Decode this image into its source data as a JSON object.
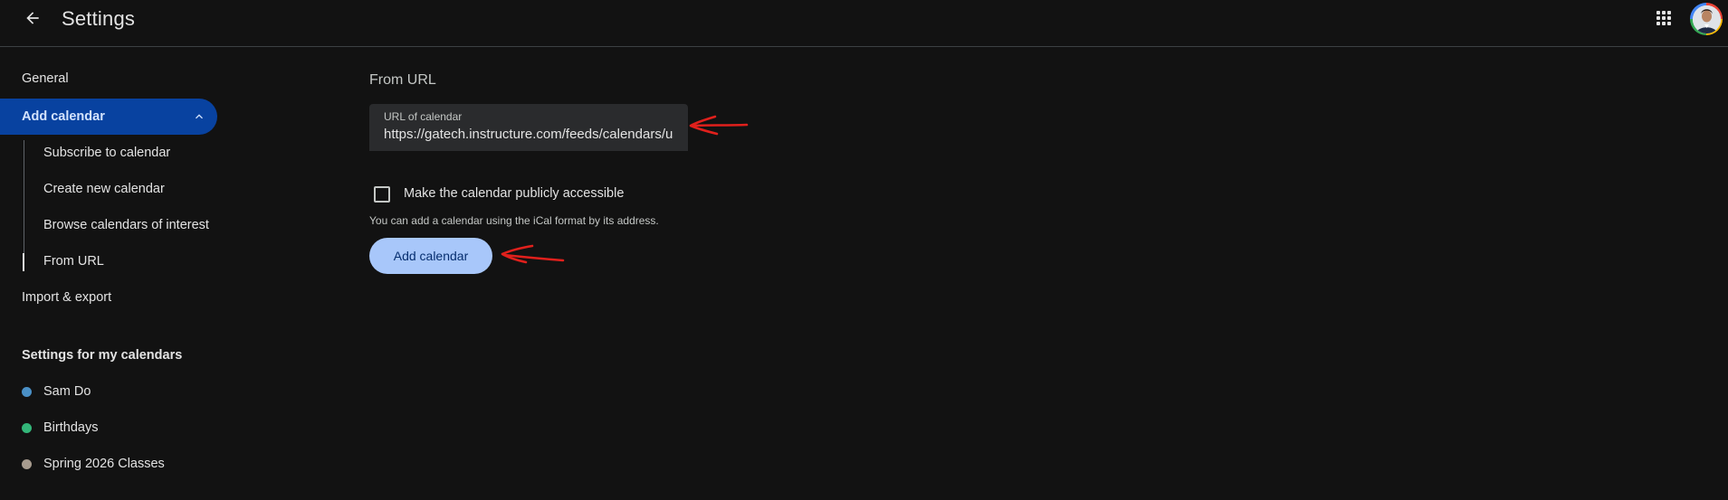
{
  "header": {
    "title": "Settings",
    "icons": {
      "back": "arrow-back-icon",
      "apps": "apps-grid-icon",
      "avatar": "account-avatar"
    }
  },
  "sidebar": {
    "general": "General",
    "add_calendar": {
      "label": "Add calendar",
      "expanded": true,
      "children": [
        "Subscribe to calendar",
        "Create new calendar",
        "Browse calendars of interest",
        "From URL"
      ],
      "active_child": "From URL"
    },
    "import_export": "Import & export",
    "my_calendars_heading": "Settings for my calendars",
    "my_calendars": [
      {
        "label": "Sam Do",
        "color": "#4a90c6"
      },
      {
        "label": "Birthdays",
        "color": "#33b679"
      },
      {
        "label": "Spring 2026 Classes",
        "color": "#a79b8e"
      }
    ]
  },
  "main": {
    "section_title": "From URL",
    "url_field": {
      "label": "URL of calendar",
      "value": "https://gatech.instructure.com/feeds/calendars/user_"
    },
    "public_checkbox": {
      "label": "Make the calendar publicly accessible",
      "checked": false
    },
    "help_text": "You can add a calendar using the iCal format by its address.",
    "add_button": "Add calendar"
  },
  "colors": {
    "background": "#121212",
    "active_nav": "#0842a0",
    "primary_button": "#a8c7fa",
    "annotation": "#e0201c"
  }
}
